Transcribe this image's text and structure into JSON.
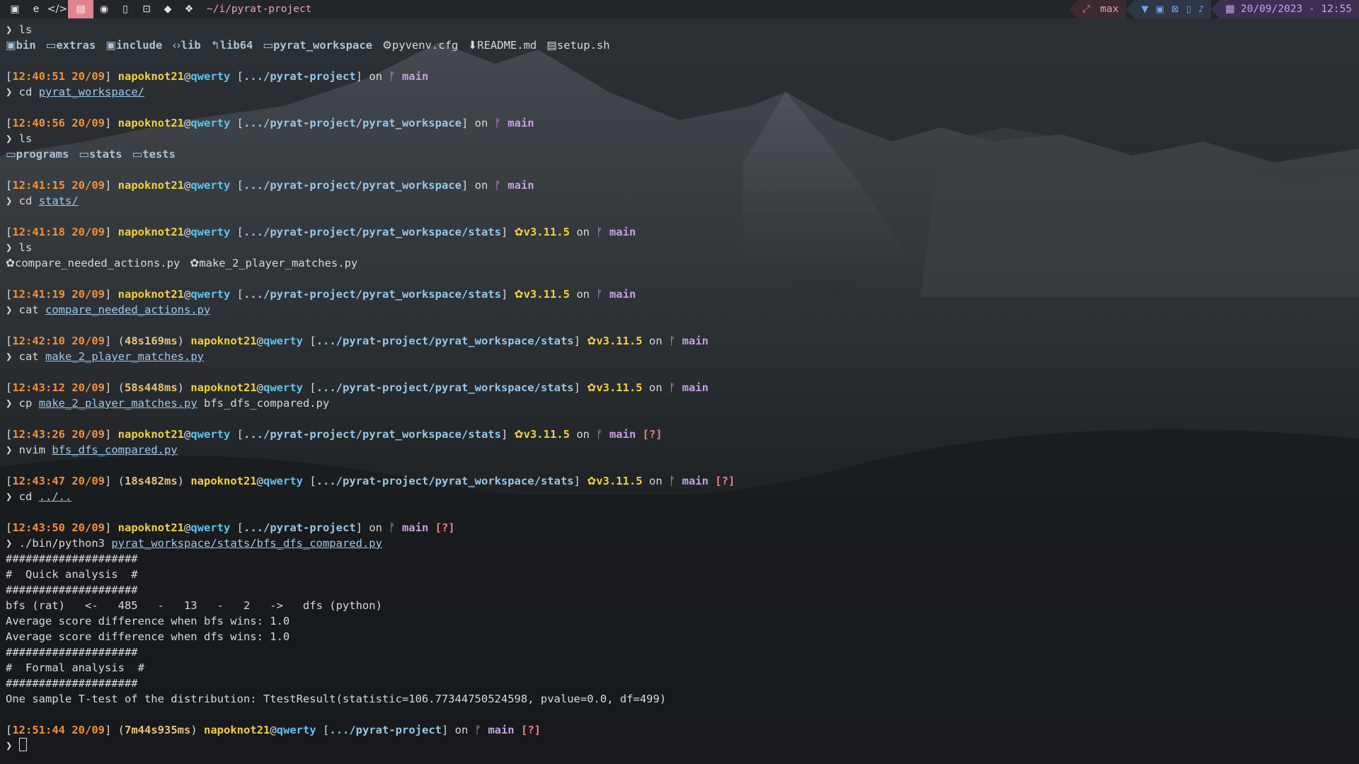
{
  "topbar": {
    "title": "~/i/pyrat-project",
    "layout_label": "max",
    "datetime": "20/09/2023 - 12:55"
  },
  "ls1": {
    "cmd": "ls",
    "items": [
      {
        "name": "bin",
        "type": "dir",
        "icon": "folder-bin"
      },
      {
        "name": "extras",
        "type": "dir",
        "icon": "folder"
      },
      {
        "name": "include",
        "type": "dir",
        "icon": "folder-bin"
      },
      {
        "name": "lib",
        "type": "dir",
        "icon": "code"
      },
      {
        "name": "lib64",
        "type": "dir",
        "icon": "folder-link"
      },
      {
        "name": "pyrat_workspace",
        "type": "dir",
        "icon": "folder"
      },
      {
        "name": "pyvenv.cfg",
        "type": "file",
        "icon": "gear"
      },
      {
        "name": "README.md",
        "type": "file",
        "icon": "download"
      },
      {
        "name": "setup.sh",
        "type": "file",
        "icon": "terminal"
      }
    ]
  },
  "prompts": [
    {
      "time": "12:40:51 20/09",
      "user": "napoknot21",
      "host": "qwerty",
      "path": ".../pyrat-project",
      "branch": "main",
      "cmd": "cd",
      "arg": "pyrat_workspace/"
    },
    {
      "time": "12:40:56 20/09",
      "user": "napoknot21",
      "host": "qwerty",
      "path": ".../pyrat-project/pyrat_workspace",
      "branch": "main",
      "cmd": "ls"
    },
    {
      "time": "12:41:15 20/09",
      "user": "napoknot21",
      "host": "qwerty",
      "path": ".../pyrat-project/pyrat_workspace",
      "branch": "main",
      "cmd": "cd",
      "arg": "stats/"
    },
    {
      "time": "12:41:18 20/09",
      "user": "napoknot21",
      "host": "qwerty",
      "path": ".../pyrat-project/pyrat_workspace/stats",
      "python": "v3.11.5",
      "branch": "main",
      "cmd": "ls"
    },
    {
      "time": "12:41:19 20/09",
      "user": "napoknot21",
      "host": "qwerty",
      "path": ".../pyrat-project/pyrat_workspace/stats",
      "python": "v3.11.5",
      "branch": "main",
      "cmd": "cat",
      "arg": "compare_needed_actions.py"
    },
    {
      "time": "12:42:10 20/09",
      "duration": "48s169ms",
      "user": "napoknot21",
      "host": "qwerty",
      "path": ".../pyrat-project/pyrat_workspace/stats",
      "python": "v3.11.5",
      "branch": "main",
      "cmd": "cat",
      "arg": "make_2_player_matches.py"
    },
    {
      "time": "12:43:12 20/09",
      "duration": "58s448ms",
      "user": "napoknot21",
      "host": "qwerty",
      "path": ".../pyrat-project/pyrat_workspace/stats",
      "python": "v3.11.5",
      "branch": "main",
      "cmd": "cp",
      "arg": "make_2_player_matches.py",
      "arg2": "bfs_dfs_compared.py"
    },
    {
      "time": "12:43:26 20/09",
      "user": "napoknot21",
      "host": "qwerty",
      "path": ".../pyrat-project/pyrat_workspace/stats",
      "python": "v3.11.5",
      "branch": "main",
      "status": "[?]",
      "cmd": "nvim",
      "arg": "bfs_dfs_compared.py"
    },
    {
      "time": "12:43:47 20/09",
      "duration": "18s482ms",
      "user": "napoknot21",
      "host": "qwerty",
      "path": ".../pyrat-project/pyrat_workspace/stats",
      "python": "v3.11.5",
      "branch": "main",
      "status": "[?]",
      "cmd": "cd",
      "arg": "../.."
    },
    {
      "time": "12:43:50 20/09",
      "user": "napoknot21",
      "host": "qwerty",
      "path": ".../pyrat-project",
      "branch": "main",
      "status": "[?]",
      "cmd": "./bin/python3",
      "arg": "pyrat_workspace/stats/bfs_dfs_compared.py"
    },
    {
      "time": "12:51:44 20/09",
      "duration": "7m44s935ms",
      "user": "napoknot21",
      "host": "qwerty",
      "path": ".../pyrat-project",
      "branch": "main",
      "status": "[?]",
      "cmd": ""
    }
  ],
  "ls_workspace": [
    "programs",
    "stats",
    "tests"
  ],
  "ls_stats": [
    "compare_needed_actions.py",
    "make_2_player_matches.py"
  ],
  "output": [
    "####################",
    "#  Quick analysis  #",
    "####################",
    "bfs (rat)   <-   485   -   13   -   2   ->   dfs (python)",
    "Average score difference when bfs wins: 1.0",
    "Average score difference when dfs wins: 1.0",
    "####################",
    "#  Formal analysis  #",
    "####################",
    "One sample T-test of the distribution: TtestResult(statistic=106.77344750524598, pvalue=0.0, df=499)"
  ],
  "colors": {
    "time": "#f0913b",
    "user": "#f4d03f",
    "host": "#5ec3f0",
    "path": "#98c6e5",
    "branch": "#c89fe0",
    "status": "#ef7d86",
    "accent_tab": "#e0848f"
  }
}
